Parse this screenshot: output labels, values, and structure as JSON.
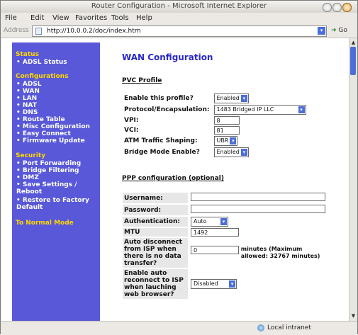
{
  "window": {
    "title": "Router Configuration - Microsoft Internet Explorer"
  },
  "menu": [
    "File",
    "Edit",
    "View",
    "Favorites",
    "Tools",
    "Help"
  ],
  "address": {
    "label": "Address",
    "url": "http://10.0.0.2/doc/index.htm",
    "go": "Go"
  },
  "sidebar": {
    "status_title": "Status",
    "status_items": [
      "ADSL Status"
    ],
    "config_title": "Configurations",
    "config_items": [
      "ADSL",
      "WAN",
      "LAN",
      "NAT",
      "DNS",
      "Route Table",
      "Misc Configuration",
      "Easy Connect",
      "Firmware Update"
    ],
    "security_title": "Security",
    "security_items": [
      "Port Forwarding",
      "Bridge Filtering",
      "DMZ",
      "Save Settings / Reboot",
      "Restore to Factory Default"
    ],
    "normal_mode": "To Normal Mode"
  },
  "content": {
    "title": "WAN Configuration",
    "pvc_title": "PVC Profile",
    "pvc_rows": {
      "enable_label": "Enable this profile?",
      "enable_value": "Enabled",
      "protocol_label": "Protocol/Encapsulation:",
      "protocol_value": "1483 Bridged IP LLC",
      "vpi_label": "VPI:",
      "vpi_value": "8",
      "vci_label": "VCI:",
      "vci_value": "81",
      "atm_label": "ATM Traffic Shaping:",
      "atm_value": "UBR",
      "bridge_label": "Bridge Mode Enable?",
      "bridge_value": "Enabled"
    },
    "ppp_title": "PPP configuration (optional)",
    "ppp_rows": {
      "username_label": "Username:",
      "username_value": "",
      "password_label": "Password:",
      "password_value": "",
      "auth_label": "Authentication:",
      "auth_value": "Auto",
      "mtu_label": "MTU",
      "mtu_value": "1492",
      "autodisc_label": "Auto disconnect from ISP when there is no data transfer?",
      "autodisc_value": "0",
      "autodisc_hint": "minutes (Maximum allowed: 32767 minutes)",
      "autorecon_label": "Enable auto reconnect to ISP when lauching web browser?",
      "autorecon_value": "Disabled"
    }
  },
  "status": {
    "zone": "Local intranet"
  }
}
